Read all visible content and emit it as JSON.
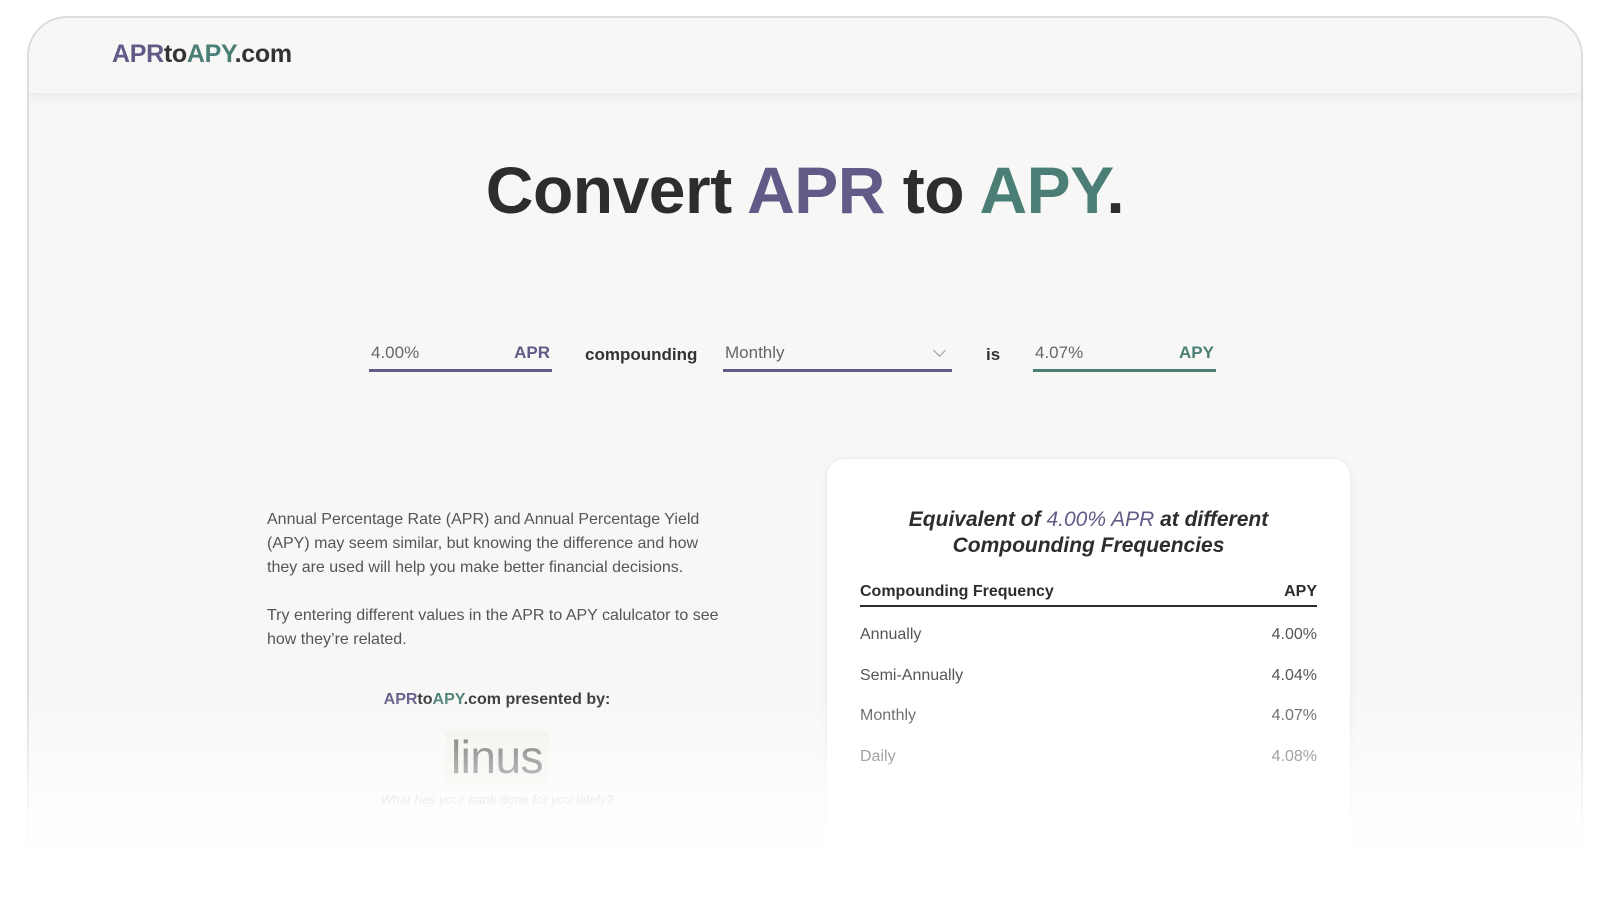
{
  "header": {
    "logo_apr": "APR",
    "logo_to": "to",
    "logo_apy": "APY",
    "logo_com": ".com"
  },
  "headline": {
    "word1": "Convert ",
    "apr": "APR",
    "word2": " to ",
    "apy": "APY",
    "period": "."
  },
  "calculator": {
    "apr_value": "4.00%",
    "apr_unit": "APR",
    "compounding_label": "compounding",
    "frequency_selected": "Monthly",
    "is_label": "is",
    "apy_value": "4.07%",
    "apy_unit": "APY"
  },
  "description": {
    "paragraph1": "Annual Percentage Rate (APR) and Annual Percentage Yield (APY) may seem similar, but knowing the difference and how they are used will help you make better financial decisions.",
    "paragraph2": "Try entering different values in the APR to APY calulcator to see how they’re related."
  },
  "sponsor": {
    "apr": "APR",
    "to": "to",
    "apy": "APY",
    "rest": ".com presented by:",
    "brand": "linus",
    "tagline": "What has your bank done for you lately?"
  },
  "card": {
    "title_prefix": "Equivalent of ",
    "title_highlight": "4.00% APR",
    "title_suffix": " at different",
    "title_line2": "Compounding Frequencies",
    "col_frequency": "Compounding Frequency",
    "col_apy": "APY",
    "rows": [
      {
        "frequency": "Annually",
        "apy": "4.00%"
      },
      {
        "frequency": "Semi-Annually",
        "apy": "4.04%"
      },
      {
        "frequency": "Monthly",
        "apy": "4.07%"
      },
      {
        "frequency": "Daily",
        "apy": "4.08%"
      }
    ]
  },
  "colors": {
    "apr_purple": "#625a87",
    "apy_green": "#4b7f76",
    "text_dark": "#2d2d2d"
  }
}
